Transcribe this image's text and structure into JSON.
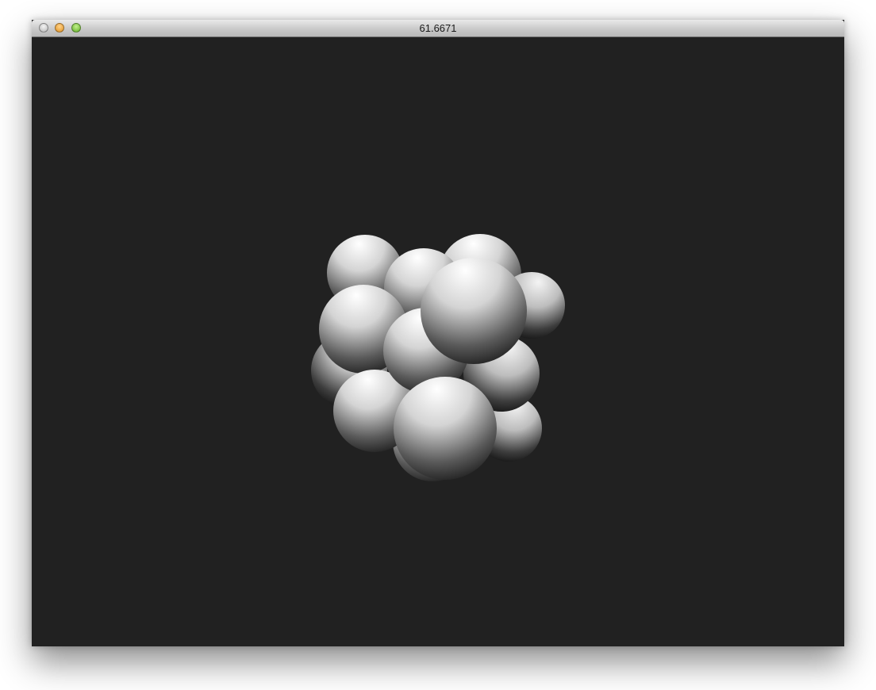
{
  "window": {
    "title": "61.6671"
  },
  "scene": {
    "background_color": "#212121",
    "object": "sphere-cluster"
  }
}
